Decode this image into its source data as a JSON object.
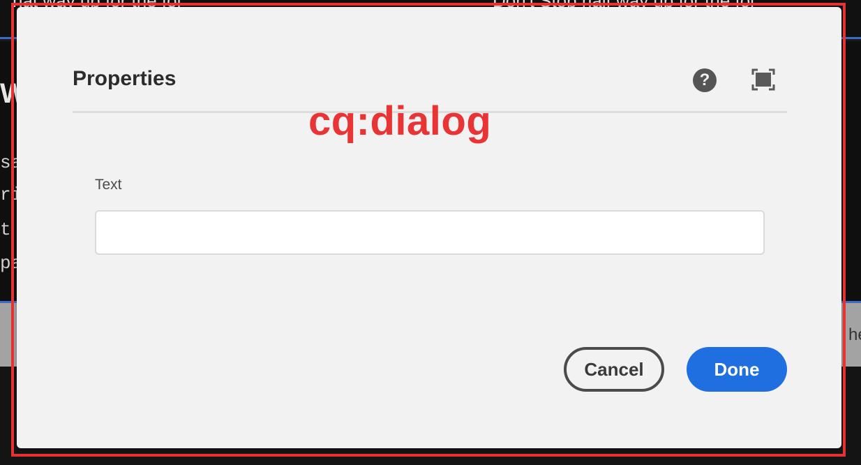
{
  "background": {
    "top_text_left": "hat way up for the fol",
    "top_text_right": "Don't Stop half way up for the fol",
    "heading_fragment": "W",
    "lines": [
      "sa",
      "ri",
      "  t",
      "pa"
    ],
    "gray_band_text": "he"
  },
  "annotation": {
    "label": "cq:dialog",
    "color": "#e83434"
  },
  "dialog": {
    "title": "Properties",
    "help_icon": "help-icon",
    "fullscreen_icon": "fullscreen-icon",
    "field": {
      "label": "Text",
      "value": "",
      "placeholder": ""
    },
    "buttons": {
      "cancel_label": "Cancel",
      "done_label": "Done"
    },
    "accent_color": "#1f6fe0"
  }
}
